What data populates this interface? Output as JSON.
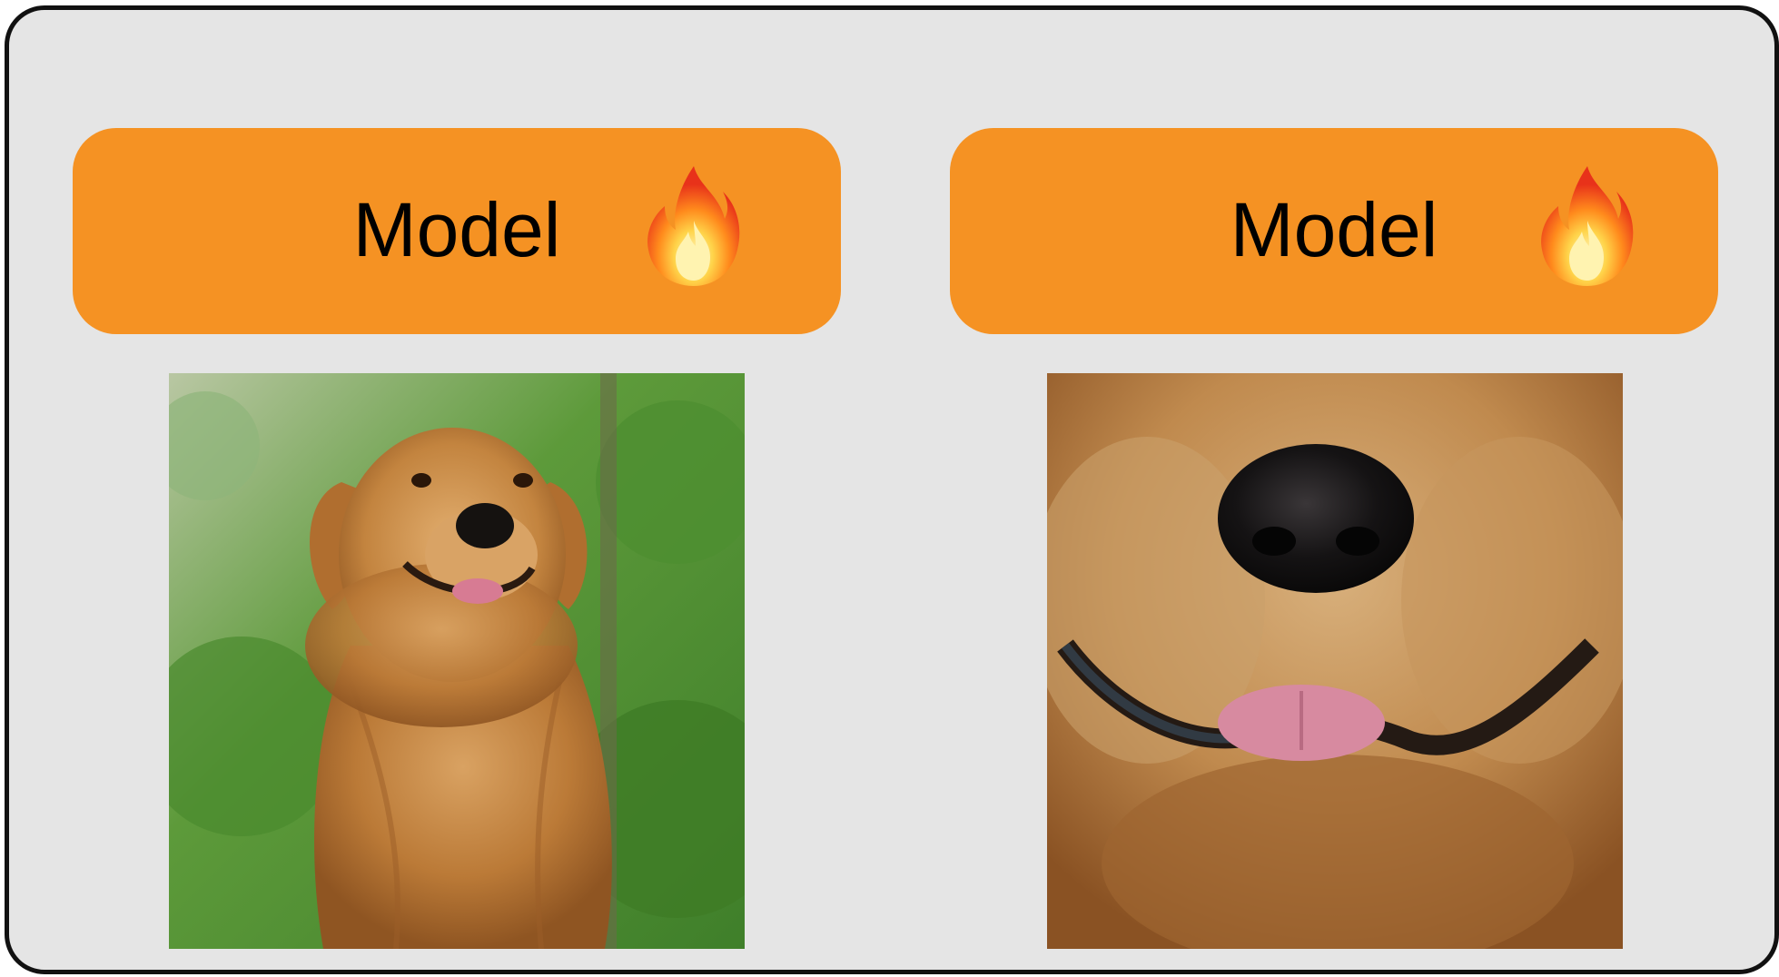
{
  "panels": [
    {
      "model_label": "Model",
      "icon": "fire-icon",
      "image": "golden-retriever-full-photo"
    },
    {
      "model_label": "Model",
      "icon": "fire-icon",
      "image": "golden-retriever-nose-closeup-photo"
    }
  ],
  "colors": {
    "frame_background": "#e5e5e5",
    "model_box": "#f59223",
    "frame_border": "#111111"
  }
}
